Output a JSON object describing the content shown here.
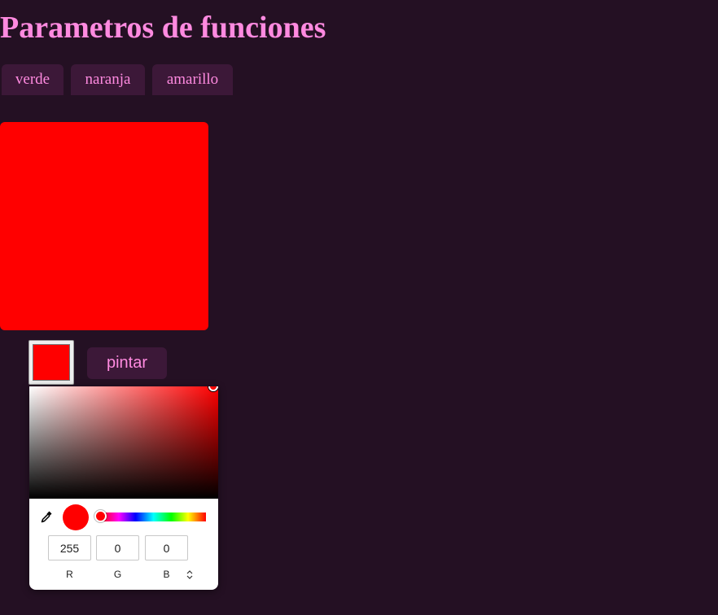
{
  "page": {
    "title": "Parametros de funciones",
    "background": "#241023",
    "accent_text": "#ff8ae0",
    "button_background": "#3c1838"
  },
  "color_buttons": [
    {
      "label": "verde"
    },
    {
      "label": "naranja"
    },
    {
      "label": "amarillo"
    }
  ],
  "canvas": {
    "fill_color": "#ff0000"
  },
  "controls": {
    "color_input_value": "#ff0000",
    "paint_button_label": "pintar"
  },
  "color_picker": {
    "hue_color": "#ff0000",
    "preview_color": "#ff0000",
    "hue_fraction": 0,
    "fields": [
      {
        "channel": "R",
        "value": "255"
      },
      {
        "channel": "G",
        "value": "0"
      },
      {
        "channel": "B",
        "value": "0"
      }
    ],
    "mode_toggle_icon": "up-down-chevron-icon",
    "eyedropper_icon": "eyedropper-icon"
  }
}
